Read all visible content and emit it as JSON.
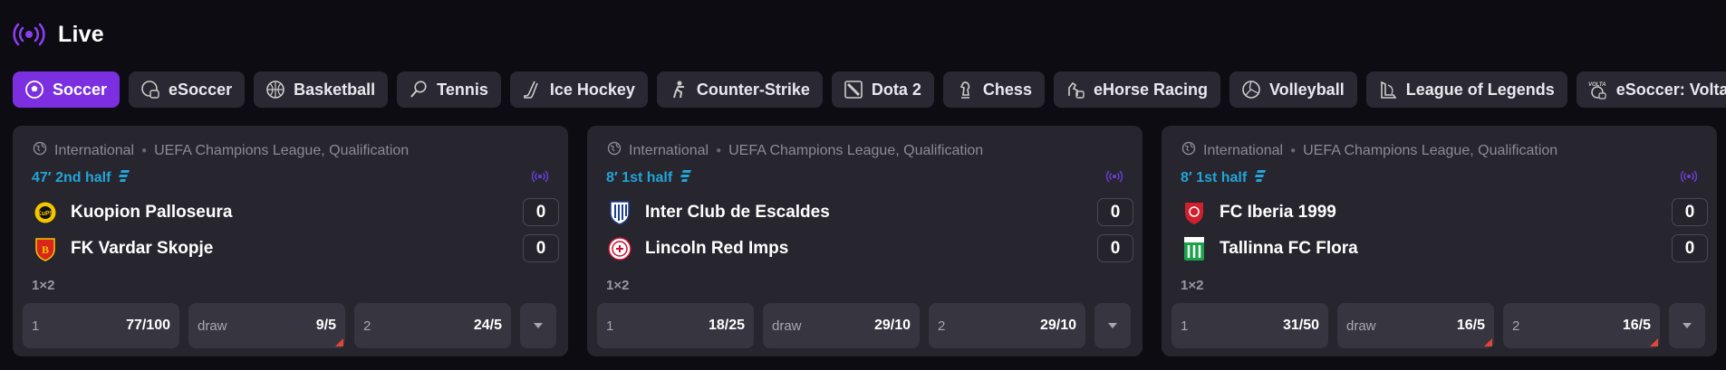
{
  "header": {
    "title": "Live"
  },
  "tabs": [
    {
      "label": "Soccer",
      "icon": "soccer-ball-icon",
      "active": true
    },
    {
      "label": "eSoccer",
      "icon": "esoccer-icon"
    },
    {
      "label": "Basketball",
      "icon": "basketball-icon"
    },
    {
      "label": "Tennis",
      "icon": "tennis-icon"
    },
    {
      "label": "Ice Hockey",
      "icon": "ice-hockey-icon"
    },
    {
      "label": "Counter-Strike",
      "icon": "counter-strike-icon"
    },
    {
      "label": "Dota 2",
      "icon": "dota2-icon"
    },
    {
      "label": "Chess",
      "icon": "chess-icon"
    },
    {
      "label": "eHorse Racing",
      "icon": "ehorse-racing-icon"
    },
    {
      "label": "Volleyball",
      "icon": "volleyball-icon"
    },
    {
      "label": "League of Legends",
      "icon": "league-of-legends-icon"
    },
    {
      "label": "eSoccer: Volta",
      "icon": "esoccer-volta-icon"
    }
  ],
  "colors": {
    "accent": "#7b2fe0",
    "live_blue": "#22a5d8",
    "live_purple": "#6b3fd8",
    "card_bg": "#27252e",
    "odd_bg": "#37353f"
  },
  "matches": [
    {
      "region": "International",
      "league": "UEFA Champions League, Qualification",
      "status": "47′ 2nd half",
      "home": {
        "name": "Kuopion Palloseura",
        "score": "0"
      },
      "away": {
        "name": "FK Vardar Skopje",
        "score": "0"
      },
      "market": "1×2",
      "odds": [
        {
          "label": "1",
          "value": "77/100",
          "changed": false
        },
        {
          "label": "draw",
          "value": "9/5",
          "changed": true
        },
        {
          "label": "2",
          "value": "24/5",
          "changed": false
        }
      ]
    },
    {
      "region": "International",
      "league": "UEFA Champions League, Qualification",
      "status": "8′ 1st half",
      "home": {
        "name": "Inter Club de Escaldes",
        "score": "0"
      },
      "away": {
        "name": "Lincoln Red Imps",
        "score": "0"
      },
      "market": "1×2",
      "odds": [
        {
          "label": "1",
          "value": "18/25",
          "changed": false
        },
        {
          "label": "draw",
          "value": "29/10",
          "changed": false
        },
        {
          "label": "2",
          "value": "29/10",
          "changed": false
        }
      ]
    },
    {
      "region": "International",
      "league": "UEFA Champions League, Qualification",
      "status": "8′ 1st half",
      "home": {
        "name": "FC Iberia 1999",
        "score": "0"
      },
      "away": {
        "name": "Tallinna FC Flora",
        "score": "0"
      },
      "market": "1×2",
      "odds": [
        {
          "label": "1",
          "value": "31/50",
          "changed": false
        },
        {
          "label": "draw",
          "value": "16/5",
          "changed": true
        },
        {
          "label": "2",
          "value": "16/5",
          "changed": true
        }
      ]
    }
  ]
}
